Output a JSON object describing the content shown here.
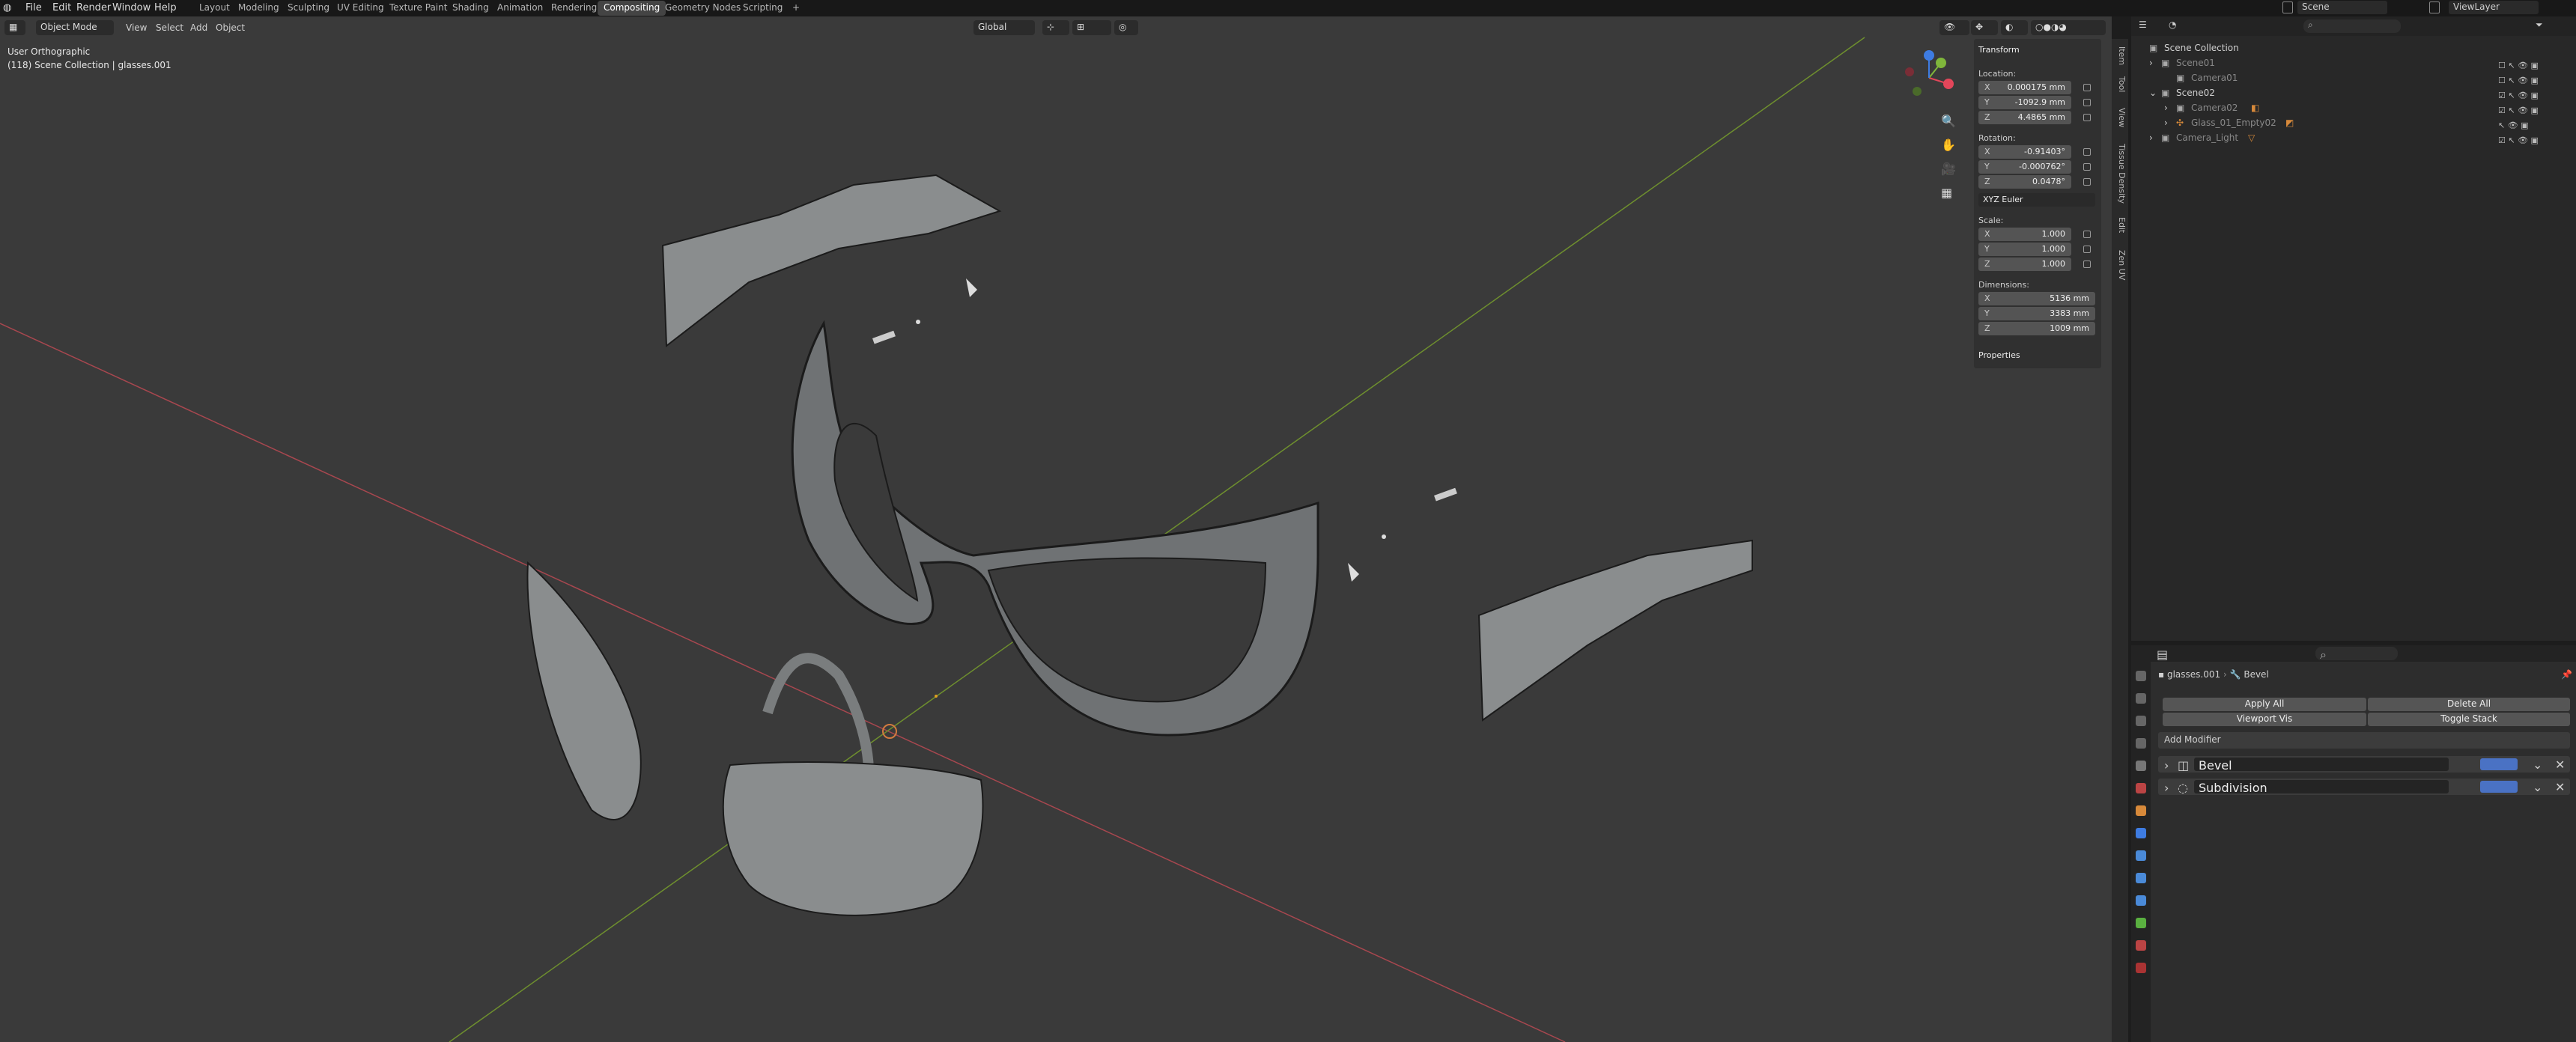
{
  "topbar": {
    "menus": [
      "File",
      "Edit",
      "Render",
      "Window",
      "Help"
    ],
    "workspaces": [
      "Layout",
      "Modeling",
      "Sculpting",
      "UV Editing",
      "Texture Paint",
      "Shading",
      "Animation",
      "Rendering",
      "Compositing",
      "Geometry Nodes",
      "Scripting"
    ],
    "active_workspace": "Compositing",
    "add_tab": "+",
    "scene_label": "Scene",
    "viewlayer_label": "ViewLayer"
  },
  "viewport": {
    "mode": "Object Mode",
    "menus": [
      "View",
      "Select",
      "Add",
      "Object"
    ],
    "orientation": "Global",
    "view_name": "User Orthographic",
    "collection_info": "(118) Scene Collection | glasses.001",
    "axis_colors": {
      "x": "#e3465a",
      "y": "#7fb63b",
      "z": "#3e7ce2"
    }
  },
  "npanel": {
    "header": "Transform",
    "location_label": "Location:",
    "location": {
      "x": "0.000175 mm",
      "y": "-1092.9 mm",
      "z": "4.4865 mm"
    },
    "rotation_label": "Rotation:",
    "rotation": {
      "x": "-0.91403°",
      "y": "-0.000762°",
      "z": "0.0478°"
    },
    "rotation_mode": "XYZ Euler",
    "scale_label": "Scale:",
    "scale": {
      "x": "1.000",
      "y": "1.000",
      "z": "1.000"
    },
    "dimensions_label": "Dimensions:",
    "dimensions": {
      "x": "5136 mm",
      "y": "3383 mm",
      "z": "1009 mm"
    },
    "properties": "Properties",
    "axes": [
      "X",
      "Y",
      "Z"
    ],
    "tabs": [
      "Item",
      "Tool",
      "View",
      "Tissue Density",
      "Edit",
      "Zen UV"
    ]
  },
  "outliner": {
    "root": "Scene Collection",
    "items": [
      "Scene01",
      "Camera01",
      "Scene02",
      "Camera02",
      "Glass_01_Empty02",
      "Camera_Light"
    ]
  },
  "properties": {
    "object": "glasses.001",
    "modifier_crumb": "Bevel",
    "apply_all": "Apply All",
    "delete_all": "Delete All",
    "viewport_vis": "Viewport Vis",
    "toggle_stack": "Toggle Stack",
    "add_modifier": "Add Modifier",
    "modifiers": [
      "Bevel",
      "Subdivision"
    ]
  }
}
